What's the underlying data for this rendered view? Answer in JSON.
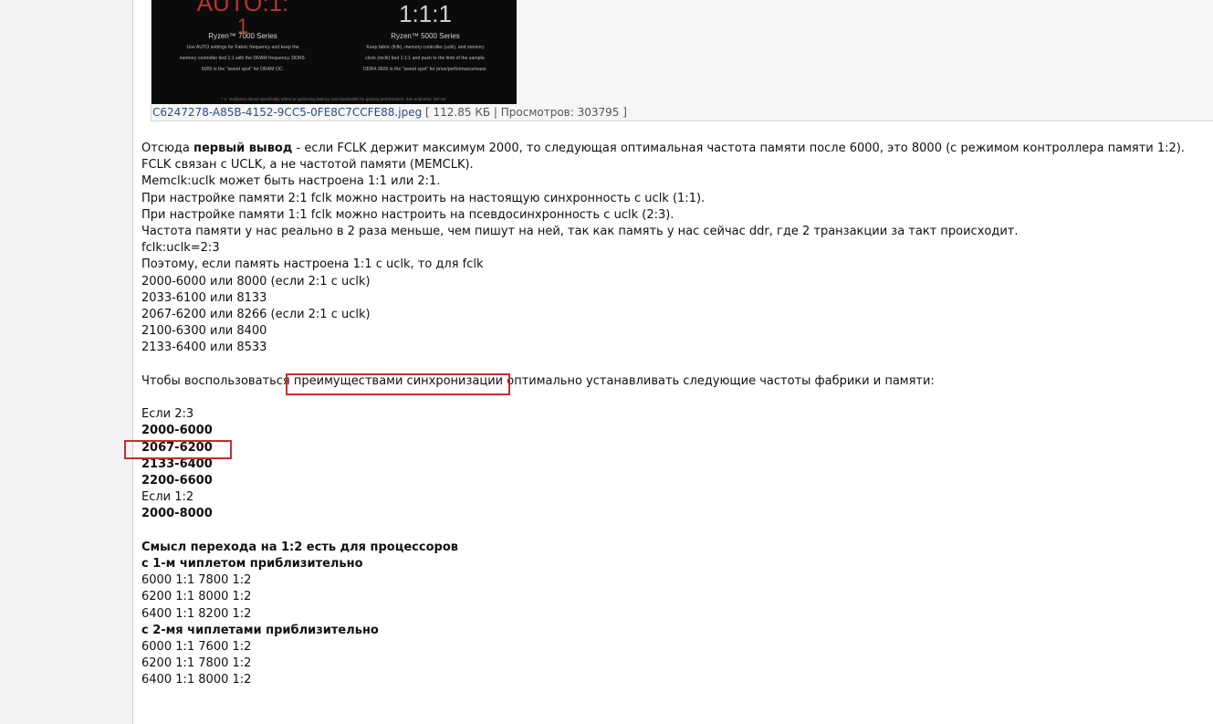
{
  "attachment": {
    "promo": {
      "left_big": "AUTO:1:",
      "left_big2": "1",
      "left_series": "Ryzen™ 7000 Series",
      "left_desc": "Use AUTO settings for Fabric frequency and keep the memory controller tied 1:1 with the DRAM frequency. DDR5-6000 is the \"sweet spot\" for DRAM OC.",
      "right_big": "1:1:1",
      "right_series": "Ryzen™ 5000 Series",
      "right_desc": "Keep fabric (fclk), memory controller (uclk), and memory clock (mclk) tied 1:1:1 and push to the limit of the sample. DDR4-3600 is the \"sweet spot\" for price/performance/ease.",
      "footnote": "* 1. Guidance above specifically refers to optimizing latency over bandwidth for gaming performance. See endnotes: GD-26."
    },
    "file_name": "C6247278-A85B-4152-9CC5-0FE8C7CCFE88.jpeg",
    "meta": " [ 112.85 КБ | Просмотров: 303795 ]"
  },
  "post": {
    "l1_pre": "Отсюда ",
    "l1_bold": "первый вывод",
    "l1_post": " - если FCLK держит максимум 2000, то следующая оптимальная частота памяти после 6000, это 8000 (с режимом контроллера памяти 1:2).",
    "l2": "FCLK связан с UCLK, а не частотой памяти (MEMCLK).",
    "l3": "Memclk:uclk может быть настроена 1:1 или 2:1.",
    "l4": "При настройке памяти 2:1 fclk можно настроить на настоящую синхронность с uclk (1:1).",
    "l5": "При настройке памяти 1:1 fclk можно настроить на псевдосинхронность с uclk (2:3).",
    "l6": "Частота памяти у нас реально в 2 раза меньше, чем пишут на ней, так как память у нас сейчас ddr, где 2 транзакции за такт происходит.",
    "l7": "fclk:uclk=2:3",
    "l8": "Поэтому, если память настроена 1:1 с uclk, то для fclk",
    "l9": "2000-6000 или 8000 (если 2:1 с uclk)",
    "l10": "2033-6100 или 8133",
    "l11": "2067-6200 или 8266 (если 2:1 с uclk)",
    "l12": "2100-6300 или 8400",
    "l13": "2133-6400 или 8533",
    "l14": "Чтобы воспользоваться преимуществами синхронизации оптимально устанавливать следующие частоты фабрики и памяти:",
    "l15": "Если 2:3",
    "b1": "2000-6000",
    "b2": "2067-6200",
    "b3": "2133-6400",
    "b4": "2200-6600",
    "l16": "Если 1:2",
    "b5": "2000-8000",
    "h1": "Смысл перехода на 1:2 есть для процессоров",
    "h2": "с 1-м чиплетом приблизительно",
    "r1": "6000 1:1 7800 1:2",
    "r2": "6200 1:1 8000 1:2",
    "r3": "6400 1:1 8200 1:2",
    "h3": "с 2-мя чиплетами приблизительно",
    "r4": "6000 1:1 7600 1:2",
    "r5": "6200 1:1 7800 1:2",
    "r6": "6400 1:1 8000 1:2"
  },
  "colors": {
    "highlight": "#cc2a2a",
    "link": "#2b4f82"
  }
}
